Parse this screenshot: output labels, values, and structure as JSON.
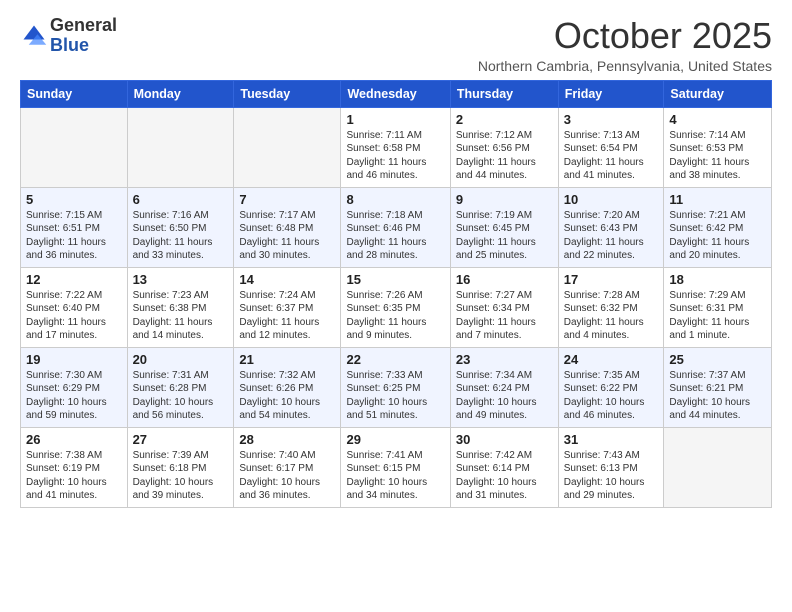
{
  "header": {
    "logo_line1": "General",
    "logo_line2": "Blue",
    "month": "October 2025",
    "location": "Northern Cambria, Pennsylvania, United States"
  },
  "days_of_week": [
    "Sunday",
    "Monday",
    "Tuesday",
    "Wednesday",
    "Thursday",
    "Friday",
    "Saturday"
  ],
  "weeks": [
    [
      {
        "day": "",
        "info": ""
      },
      {
        "day": "",
        "info": ""
      },
      {
        "day": "",
        "info": ""
      },
      {
        "day": "1",
        "info": "Sunrise: 7:11 AM\nSunset: 6:58 PM\nDaylight: 11 hours and 46 minutes."
      },
      {
        "day": "2",
        "info": "Sunrise: 7:12 AM\nSunset: 6:56 PM\nDaylight: 11 hours and 44 minutes."
      },
      {
        "day": "3",
        "info": "Sunrise: 7:13 AM\nSunset: 6:54 PM\nDaylight: 11 hours and 41 minutes."
      },
      {
        "day": "4",
        "info": "Sunrise: 7:14 AM\nSunset: 6:53 PM\nDaylight: 11 hours and 38 minutes."
      }
    ],
    [
      {
        "day": "5",
        "info": "Sunrise: 7:15 AM\nSunset: 6:51 PM\nDaylight: 11 hours and 36 minutes."
      },
      {
        "day": "6",
        "info": "Sunrise: 7:16 AM\nSunset: 6:50 PM\nDaylight: 11 hours and 33 minutes."
      },
      {
        "day": "7",
        "info": "Sunrise: 7:17 AM\nSunset: 6:48 PM\nDaylight: 11 hours and 30 minutes."
      },
      {
        "day": "8",
        "info": "Sunrise: 7:18 AM\nSunset: 6:46 PM\nDaylight: 11 hours and 28 minutes."
      },
      {
        "day": "9",
        "info": "Sunrise: 7:19 AM\nSunset: 6:45 PM\nDaylight: 11 hours and 25 minutes."
      },
      {
        "day": "10",
        "info": "Sunrise: 7:20 AM\nSunset: 6:43 PM\nDaylight: 11 hours and 22 minutes."
      },
      {
        "day": "11",
        "info": "Sunrise: 7:21 AM\nSunset: 6:42 PM\nDaylight: 11 hours and 20 minutes."
      }
    ],
    [
      {
        "day": "12",
        "info": "Sunrise: 7:22 AM\nSunset: 6:40 PM\nDaylight: 11 hours and 17 minutes."
      },
      {
        "day": "13",
        "info": "Sunrise: 7:23 AM\nSunset: 6:38 PM\nDaylight: 11 hours and 14 minutes."
      },
      {
        "day": "14",
        "info": "Sunrise: 7:24 AM\nSunset: 6:37 PM\nDaylight: 11 hours and 12 minutes."
      },
      {
        "day": "15",
        "info": "Sunrise: 7:26 AM\nSunset: 6:35 PM\nDaylight: 11 hours and 9 minutes."
      },
      {
        "day": "16",
        "info": "Sunrise: 7:27 AM\nSunset: 6:34 PM\nDaylight: 11 hours and 7 minutes."
      },
      {
        "day": "17",
        "info": "Sunrise: 7:28 AM\nSunset: 6:32 PM\nDaylight: 11 hours and 4 minutes."
      },
      {
        "day": "18",
        "info": "Sunrise: 7:29 AM\nSunset: 6:31 PM\nDaylight: 11 hours and 1 minute."
      }
    ],
    [
      {
        "day": "19",
        "info": "Sunrise: 7:30 AM\nSunset: 6:29 PM\nDaylight: 10 hours and 59 minutes."
      },
      {
        "day": "20",
        "info": "Sunrise: 7:31 AM\nSunset: 6:28 PM\nDaylight: 10 hours and 56 minutes."
      },
      {
        "day": "21",
        "info": "Sunrise: 7:32 AM\nSunset: 6:26 PM\nDaylight: 10 hours and 54 minutes."
      },
      {
        "day": "22",
        "info": "Sunrise: 7:33 AM\nSunset: 6:25 PM\nDaylight: 10 hours and 51 minutes."
      },
      {
        "day": "23",
        "info": "Sunrise: 7:34 AM\nSunset: 6:24 PM\nDaylight: 10 hours and 49 minutes."
      },
      {
        "day": "24",
        "info": "Sunrise: 7:35 AM\nSunset: 6:22 PM\nDaylight: 10 hours and 46 minutes."
      },
      {
        "day": "25",
        "info": "Sunrise: 7:37 AM\nSunset: 6:21 PM\nDaylight: 10 hours and 44 minutes."
      }
    ],
    [
      {
        "day": "26",
        "info": "Sunrise: 7:38 AM\nSunset: 6:19 PM\nDaylight: 10 hours and 41 minutes."
      },
      {
        "day": "27",
        "info": "Sunrise: 7:39 AM\nSunset: 6:18 PM\nDaylight: 10 hours and 39 minutes."
      },
      {
        "day": "28",
        "info": "Sunrise: 7:40 AM\nSunset: 6:17 PM\nDaylight: 10 hours and 36 minutes."
      },
      {
        "day": "29",
        "info": "Sunrise: 7:41 AM\nSunset: 6:15 PM\nDaylight: 10 hours and 34 minutes."
      },
      {
        "day": "30",
        "info": "Sunrise: 7:42 AM\nSunset: 6:14 PM\nDaylight: 10 hours and 31 minutes."
      },
      {
        "day": "31",
        "info": "Sunrise: 7:43 AM\nSunset: 6:13 PM\nDaylight: 10 hours and 29 minutes."
      },
      {
        "day": "",
        "info": ""
      }
    ]
  ]
}
